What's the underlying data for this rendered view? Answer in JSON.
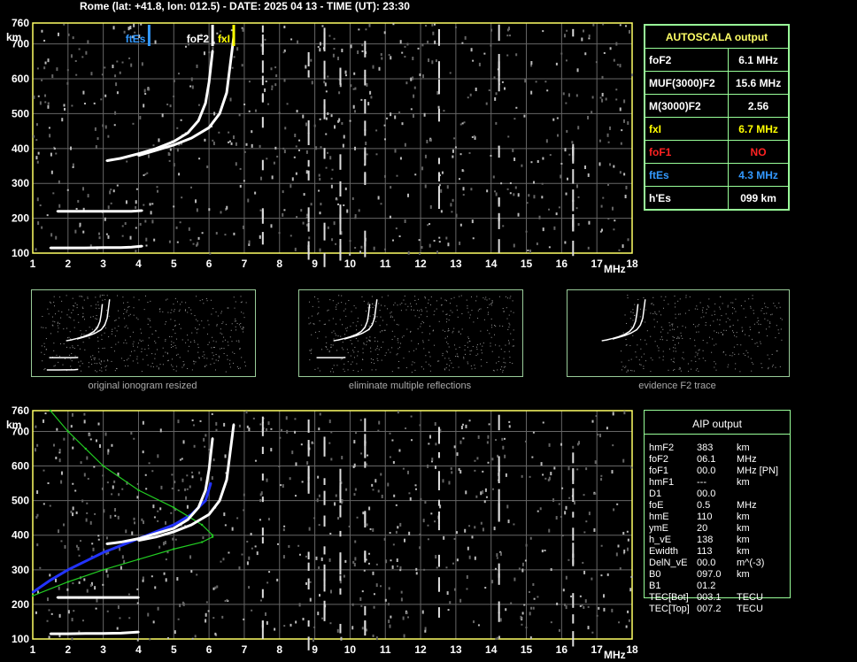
{
  "header": {
    "station": "Rome",
    "title": "Rome (lat: +41.8, lon: 012.5) - DATE: 2025 04 13 - TIME (UT): 23:30"
  },
  "colors": {
    "background": "#000000",
    "frame": "#ffff66",
    "grid": "#666666",
    "trace": "#ffffff",
    "fxi": "#ffff00",
    "ftEs": "#3399ff",
    "foF1": "#ff2222",
    "profile": "#2233ff",
    "model": "#22cc22",
    "table_border": "#99ff99"
  },
  "axes": {
    "xlabel": "MHz",
    "ylabel": "km",
    "xlim": [
      1,
      18
    ],
    "ylim": [
      100,
      760
    ],
    "xticks": [
      "1",
      "2",
      "3",
      "4",
      "5",
      "6",
      "7",
      "8",
      "9",
      "10",
      "11",
      "12",
      "13",
      "14",
      "15",
      "16",
      "17",
      "18"
    ],
    "yticks": [
      "100",
      "200",
      "300",
      "400",
      "500",
      "600",
      "700",
      "760"
    ]
  },
  "chart_data": [
    {
      "type": "scatter",
      "title": "",
      "xlabel": "MHz",
      "ylabel": "km",
      "xlim": [
        1,
        18
      ],
      "ylim": [
        100,
        760
      ],
      "grid": true,
      "markers": [
        {
          "label": "ftEs",
          "x": 4.3,
          "color": "#3399ff"
        },
        {
          "label": "foF2",
          "x": 6.1,
          "color": "#ffffff"
        },
        {
          "label": "fxI",
          "x": 6.7,
          "color": "#ffff00"
        }
      ],
      "series": [
        {
          "name": "",
          "color": "#ffffff",
          "x": [
            3.1,
            3.5,
            4.0,
            4.5,
            5.0,
            5.4,
            5.7,
            5.9,
            6.0,
            6.1
          ],
          "y": [
            365,
            372,
            385,
            400,
            420,
            445,
            480,
            530,
            590,
            680
          ]
        },
        {
          "name": "",
          "color": "#ffffff",
          "x": [
            4.0,
            4.5,
            5.0,
            5.5,
            6.0,
            6.3,
            6.5,
            6.6,
            6.7
          ],
          "y": [
            380,
            395,
            410,
            430,
            460,
            500,
            560,
            640,
            720
          ]
        },
        {
          "name": "",
          "color": "#ffffff",
          "x": [
            1.7,
            2.0,
            2.5,
            3.0,
            3.5,
            3.8,
            4.1
          ],
          "y": [
            220,
            220,
            220,
            220,
            220,
            220,
            222
          ]
        },
        {
          "name": "",
          "color": "#ffffff",
          "x": [
            1.5,
            2.0,
            2.5,
            3.0,
            3.5,
            3.8,
            4.1
          ],
          "y": [
            115,
            115,
            115,
            116,
            116,
            117,
            120
          ]
        }
      ]
    },
    {
      "type": "table",
      "title": "AUTOSCALA output",
      "rows": [
        {
          "label": "foF2",
          "value": "6.1 MHz",
          "color": "#ffffff"
        },
        {
          "label": "MUF(3000)F2",
          "value": "15.6 MHz",
          "color": "#ffffff"
        },
        {
          "label": "M(3000)F2",
          "value": "2.56",
          "color": "#ffffff"
        },
        {
          "label": "fxI",
          "value": "6.7 MHz",
          "color": "#ffff00"
        },
        {
          "label": "foF1",
          "value": "NO",
          "color": "#ff2222"
        },
        {
          "label": "ftEs",
          "value": "4.3 MHz",
          "color": "#3399ff"
        },
        {
          "label": "h'Es",
          "value": "099    km",
          "color": "#ffffff"
        }
      ]
    },
    {
      "type": "line",
      "title": "",
      "xlabel": "MHz",
      "ylabel": "km",
      "xlim": [
        1,
        18
      ],
      "ylim": [
        100,
        760
      ],
      "grid": true,
      "series": [
        {
          "name": "",
          "color": "#2233ff",
          "x": [
            1.0,
            1.5,
            2.0,
            2.5,
            3.0,
            3.5,
            4.0,
            4.5,
            5.0,
            5.5,
            5.9,
            6.05
          ],
          "y": [
            235,
            270,
            300,
            325,
            350,
            370,
            390,
            410,
            430,
            460,
            500,
            550
          ]
        },
        {
          "name": "",
          "color": "#22cc22",
          "x": [
            1.0,
            2.0,
            3.0,
            4.0,
            5.0,
            5.8,
            6.1
          ],
          "y": [
            225,
            265,
            300,
            330,
            360,
            380,
            395
          ]
        },
        {
          "name": "",
          "color": "#22cc22",
          "x": [
            1.5,
            2.0,
            2.5,
            3.0,
            4.0,
            5.0,
            5.8,
            6.1
          ],
          "y": [
            760,
            700,
            650,
            600,
            530,
            480,
            430,
            400
          ]
        },
        {
          "name": "",
          "color": "#ffffff",
          "x": [
            3.1,
            3.5,
            4.0,
            4.5,
            5.0,
            5.4,
            5.7,
            5.9,
            6.0,
            6.1
          ],
          "y": [
            375,
            380,
            390,
            405,
            420,
            445,
            480,
            530,
            590,
            680
          ]
        },
        {
          "name": "",
          "color": "#ffffff",
          "x": [
            4.0,
            4.5,
            5.0,
            5.5,
            6.0,
            6.3,
            6.5,
            6.6,
            6.7
          ],
          "y": [
            385,
            395,
            410,
            430,
            460,
            500,
            560,
            640,
            720
          ]
        },
        {
          "name": "",
          "color": "#ffffff",
          "x": [
            1.7,
            2.0,
            2.5,
            3.0,
            3.5,
            4.0
          ],
          "y": [
            220,
            220,
            220,
            220,
            220,
            220
          ]
        },
        {
          "name": "",
          "color": "#ffffff",
          "x": [
            1.5,
            2.0,
            2.5,
            3.0,
            3.5,
            4.0
          ],
          "y": [
            115,
            115,
            116,
            116,
            117,
            120
          ]
        }
      ]
    }
  ],
  "thumbnails": [
    {
      "caption": "original ionogram resized"
    },
    {
      "caption": "eliminate multiple reflections"
    },
    {
      "caption": "evidence F2 trace"
    }
  ],
  "aip": {
    "title": "AIP output",
    "rows": [
      {
        "label": "hmF2",
        "value": "383",
        "unit": "km"
      },
      {
        "label": "foF2",
        "value": "06.1",
        "unit": "MHz"
      },
      {
        "label": "foF1",
        "value": "00.0",
        "unit": "MHz   [PN]"
      },
      {
        "label": "hmF1",
        "value": "---",
        "unit": "km"
      },
      {
        "label": "D1",
        "value": "00.0",
        "unit": ""
      },
      {
        "label": "foE",
        "value": "0.5",
        "unit": "MHz"
      },
      {
        "label": "hmE",
        "value": "110",
        "unit": "km"
      },
      {
        "label": "ymE",
        "value": "20",
        "unit": "km"
      },
      {
        "label": "h_vE",
        "value": "138",
        "unit": "km"
      },
      {
        "label": "Ewidth",
        "value": "113",
        "unit": "km"
      },
      {
        "label": "DelN_vE",
        "value": "00.0",
        "unit": "m^(-3)"
      },
      {
        "label": "B0",
        "value": "097.0",
        "unit": "km"
      },
      {
        "label": "B1",
        "value": "01.2",
        "unit": ""
      },
      {
        "label": "TEC[Bot]",
        "value": "003.1",
        "unit": "TECU"
      },
      {
        "label": "TEC[Top]",
        "value": "007.2",
        "unit": "TECU"
      }
    ]
  }
}
